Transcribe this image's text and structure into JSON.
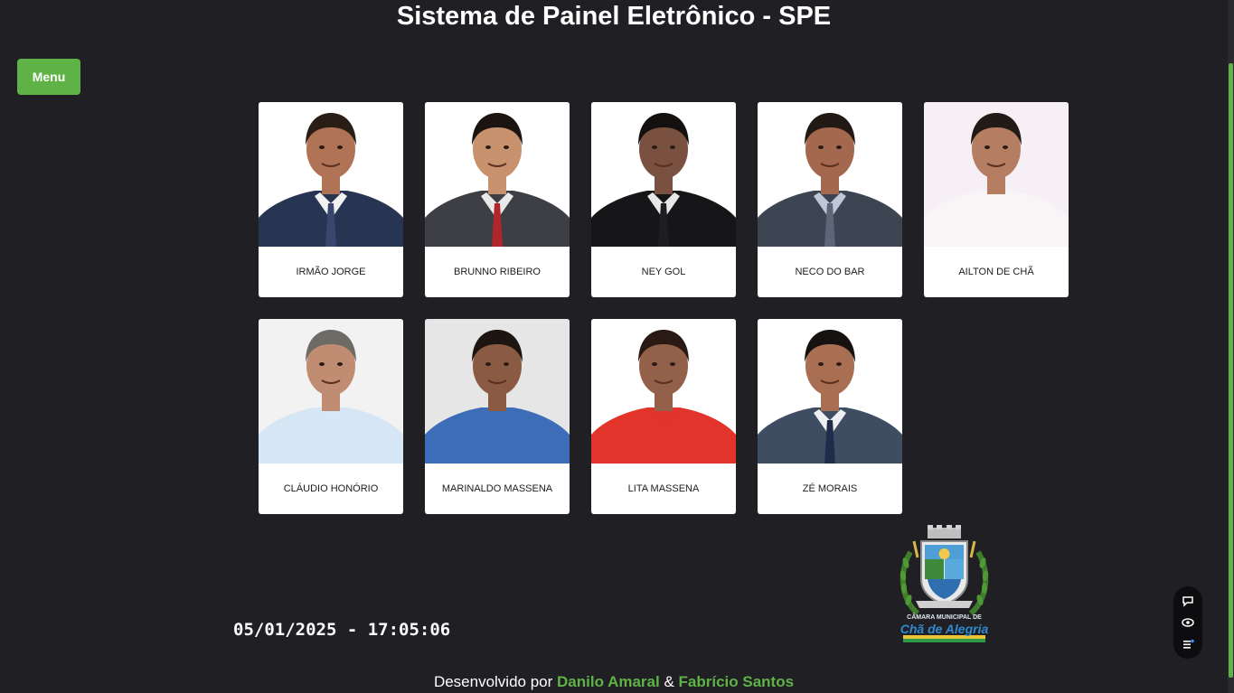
{
  "header": {
    "title": "Sistema de Painel Eletrônico - SPE"
  },
  "menu": {
    "label": "Menu"
  },
  "councilors": [
    {
      "name": "IRMÃO JORGE",
      "bg": "#ffffff",
      "skin": "#b07356",
      "hair": "#2a1d16",
      "suit": "#283552",
      "shirt": "#f2f2f2",
      "tie": "#3a4670"
    },
    {
      "name": "BRUNNO RIBEIRO",
      "bg": "#ffffff",
      "skin": "#c8926f",
      "hair": "#1b1410",
      "suit": "#3e3f44",
      "shirt": "#e9e9ea",
      "tie": "#b0262b"
    },
    {
      "name": "NEY GOL",
      "bg": "#ffffff",
      "skin": "#7a5040",
      "hair": "#141010",
      "suit": "#161618",
      "shirt": "#e7e7e7",
      "tie": "#1e1e22"
    },
    {
      "name": "NECO DO BAR",
      "bg": "#ffffff",
      "skin": "#a4684f",
      "hair": "#221915",
      "suit": "#3d4452",
      "shirt": "#bfc8d6",
      "tie": "#5c6678"
    },
    {
      "name": "AILTON DE CHÃ",
      "bg": "#f6eff6",
      "skin": "#b57d62",
      "hair": "#221a17",
      "suit": "#f7f5f6",
      "shirt": "#f7f5f6",
      "tie": ""
    },
    {
      "name": "CLÁUDIO HONÓRIO",
      "bg": "#f2f2f2",
      "skin": "#c18d72",
      "hair": "#6e6a66",
      "suit": "#d6e6f4",
      "shirt": "#d6e6f4",
      "tie": ""
    },
    {
      "name": "MARINALDO MASSENA",
      "bg": "#e6e6e6",
      "skin": "#8b5a42",
      "hair": "#1c1512",
      "suit": "#3e6db8",
      "shirt": "#3e6db8",
      "tie": ""
    },
    {
      "name": "LITA MASSENA",
      "bg": "#ffffff",
      "skin": "#93604a",
      "hair": "#2a1a14",
      "suit": "#e2342a",
      "shirt": "#e2342a",
      "tie": ""
    },
    {
      "name": "ZÉ MORAIS",
      "bg": "#ffffff",
      "skin": "#a86f53",
      "hair": "#151210",
      "suit": "#3f4d63",
      "shirt": "#eef0f3",
      "tie": "#1f2d4a"
    }
  ],
  "clock": {
    "text": "05/01/2025 - 17:05:06"
  },
  "footer": {
    "prefix": "Desenvolvido por",
    "dev1": "Danilo Amaral",
    "sep": "&",
    "dev2": "Fabrício Santos"
  },
  "logo": {
    "line1": "CÂMARA MUNICIPAL DE",
    "line2": "Chã de Alegria"
  },
  "colors": {
    "accent": "#5fb246",
    "background": "#202024",
    "card": "#ffffff"
  },
  "widget": {
    "icons": [
      "chat-icon",
      "eye-icon",
      "menu-lines-icon"
    ]
  }
}
